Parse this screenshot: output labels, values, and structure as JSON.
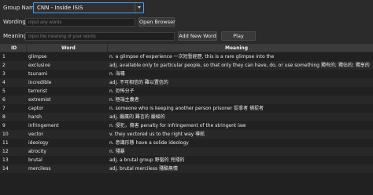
{
  "group": {
    "label": "Group Name",
    "selected": "CNN - Inside ISIS"
  },
  "wording": {
    "label": "Wording",
    "placeholder": "Input any words"
  },
  "open_browser_label": "Open Browser",
  "meaning": {
    "label": "Meaning",
    "placeholder": "Input the meaning of your words"
  },
  "add_word_label": "Add New Word",
  "play_label": "Play",
  "table": {
    "headers": {
      "id": "ID",
      "word": "Word",
      "meaning": "Meaning"
    },
    "rows": [
      {
        "id": "1",
        "word": "glimpse",
        "meaning": "n. a glimpse of experience 一次短暫經歷, this is a rare glimpse into the"
      },
      {
        "id": "2",
        "word": "exclusive",
        "meaning": "adj. available only to particular people, so that only they can have, do, or use something 獨有的; 獨佔的; 獨享的"
      },
      {
        "id": "3",
        "word": "tsunami",
        "meaning": "n. 海嘯"
      },
      {
        "id": "4",
        "word": "incredible",
        "meaning": "adj. 不可相信的 難以置信的"
      },
      {
        "id": "5",
        "word": "terrorist",
        "meaning": "n. 恐怖分子"
      },
      {
        "id": "6",
        "word": "extremist",
        "meaning": "n. 極端主義者"
      },
      {
        "id": "7",
        "word": "captor",
        "meaning": "n. someone who is keeping another person prisoner 捉拿者 捕捉者"
      },
      {
        "id": "8",
        "word": "harsh",
        "meaning": "adj. 嚴厲的 難言的 嚴峻的"
      },
      {
        "id": "9",
        "word": "infringement",
        "meaning": "n. 侵犯，傷害 penalty for infringement of the stringent law"
      },
      {
        "id": "10",
        "word": "vector",
        "meaning": "v. they vectored us to the right way 導航"
      },
      {
        "id": "11",
        "word": "ideology",
        "meaning": "n. 意識形態 have a solide ideology"
      },
      {
        "id": "12",
        "word": "atrocity",
        "meaning": "n. 殘暴"
      },
      {
        "id": "13",
        "word": "brutal",
        "meaning": "adj. a brutal group 野蠻的 兇殘的"
      },
      {
        "id": "14",
        "word": "merciless",
        "meaning": "adj. brutal merciless 殘酷無情"
      }
    ]
  }
}
